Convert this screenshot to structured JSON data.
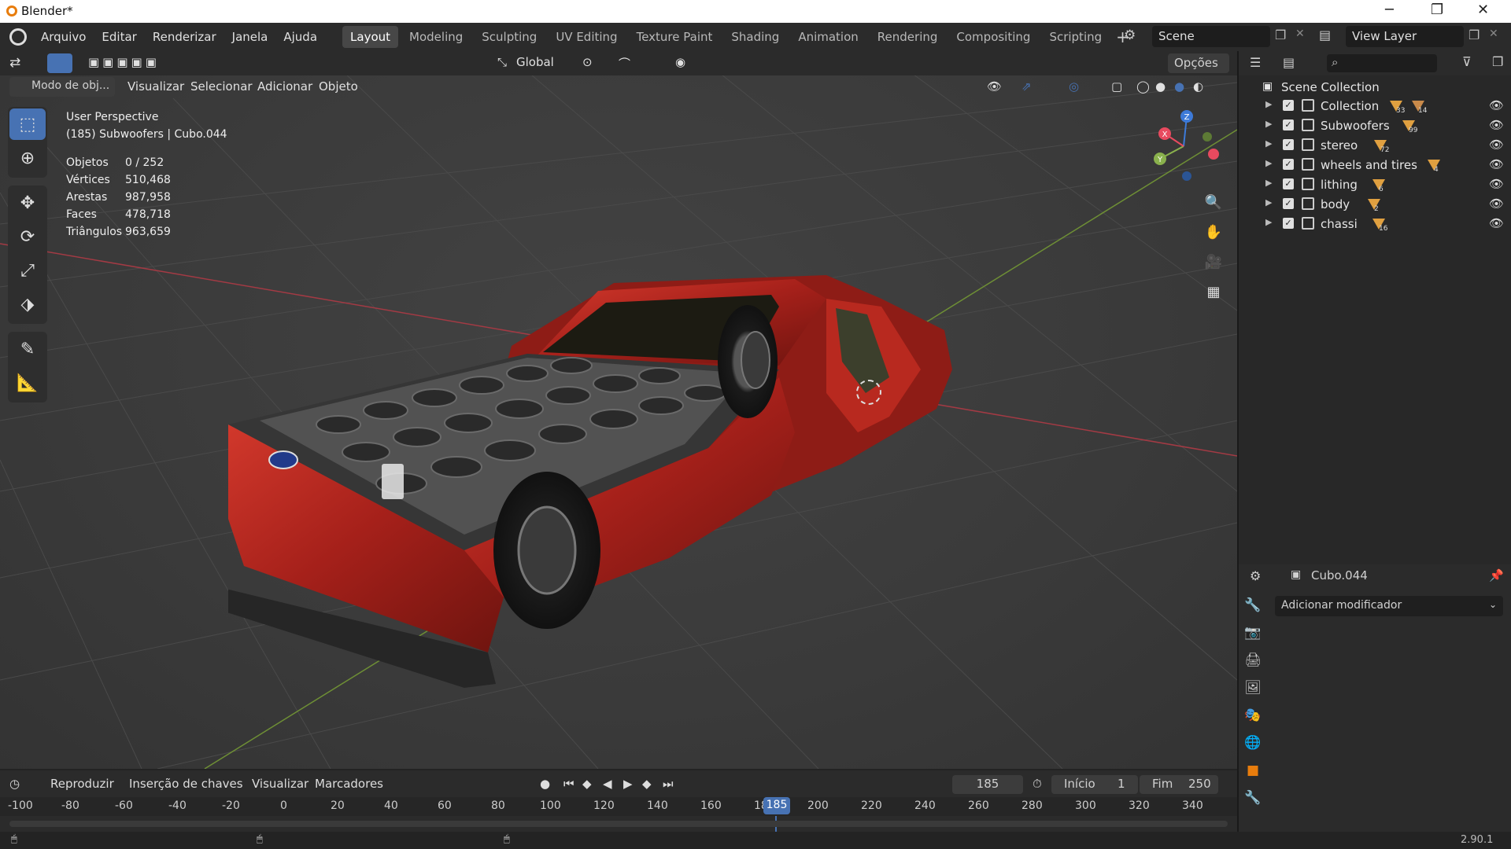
{
  "window": {
    "title": "Blender*",
    "minimize": "─",
    "maximize": "❐",
    "close": "✕"
  },
  "menu": [
    "Arquivo",
    "Editar",
    "Renderizar",
    "Janela",
    "Ajuda"
  ],
  "workspaces": [
    "Layout",
    "Modeling",
    "Sculpting",
    "UV Editing",
    "Texture Paint",
    "Shading",
    "Animation",
    "Rendering",
    "Compositing",
    "Scripting"
  ],
  "active_workspace": "Layout",
  "scene": {
    "name": "Scene",
    "view_layer": "View Layer"
  },
  "viewport_header": {
    "transform": "Global",
    "options": "Opções",
    "mode": "Modo de obj...",
    "menus": [
      "Visualizar",
      "Selecionar",
      "Adicionar",
      "Objeto"
    ]
  },
  "overlay": {
    "perspective": "User Perspective",
    "context": "(185) Subwoofers | Cubo.044",
    "stats": [
      {
        "label": "Objetos",
        "value": "0 / 252"
      },
      {
        "label": "Vértices",
        "value": "510,468"
      },
      {
        "label": "Arestas",
        "value": "987,958"
      },
      {
        "label": "Faces",
        "value": "478,718"
      },
      {
        "label": "Triângulos",
        "value": "963,659"
      }
    ]
  },
  "gizmo": {
    "x": "X",
    "y": "Y",
    "z": "Z"
  },
  "colors": {
    "accent": "#4772b3",
    "x_axis": "#e84a5f",
    "y_axis": "#8ab14d",
    "z_axis": "#3d7ad8",
    "truck": "#b0231c"
  },
  "outliner": {
    "root": "Scene Collection",
    "items": [
      {
        "name": "Collection",
        "count": "33",
        "count2": "14"
      },
      {
        "name": "Subwoofers",
        "count": "99"
      },
      {
        "name": "stereo",
        "count": "72"
      },
      {
        "name": "wheels and tires",
        "count": "4"
      },
      {
        "name": "lithing",
        "count": "6"
      },
      {
        "name": "body",
        "count": "2"
      },
      {
        "name": "chassi",
        "count": "16"
      }
    ]
  },
  "properties": {
    "object": "Cubo.044",
    "add_modifier": "Adicionar modificador"
  },
  "timeline": {
    "menus": [
      "Reproduzir",
      "Inserção de chaves",
      "Visualizar",
      "Marcadores"
    ],
    "current_frame": "185",
    "start_label": "Início",
    "start": "1",
    "end_label": "Fim",
    "end": "250",
    "ticks": [
      "-100",
      "-80",
      "-60",
      "-40",
      "-20",
      "0",
      "20",
      "40",
      "60",
      "80",
      "100",
      "120",
      "140",
      "160",
      "18",
      "200",
      "220",
      "240",
      "260",
      "280",
      "300",
      "320",
      "340"
    ]
  },
  "status": {
    "version": "2.90.1"
  }
}
